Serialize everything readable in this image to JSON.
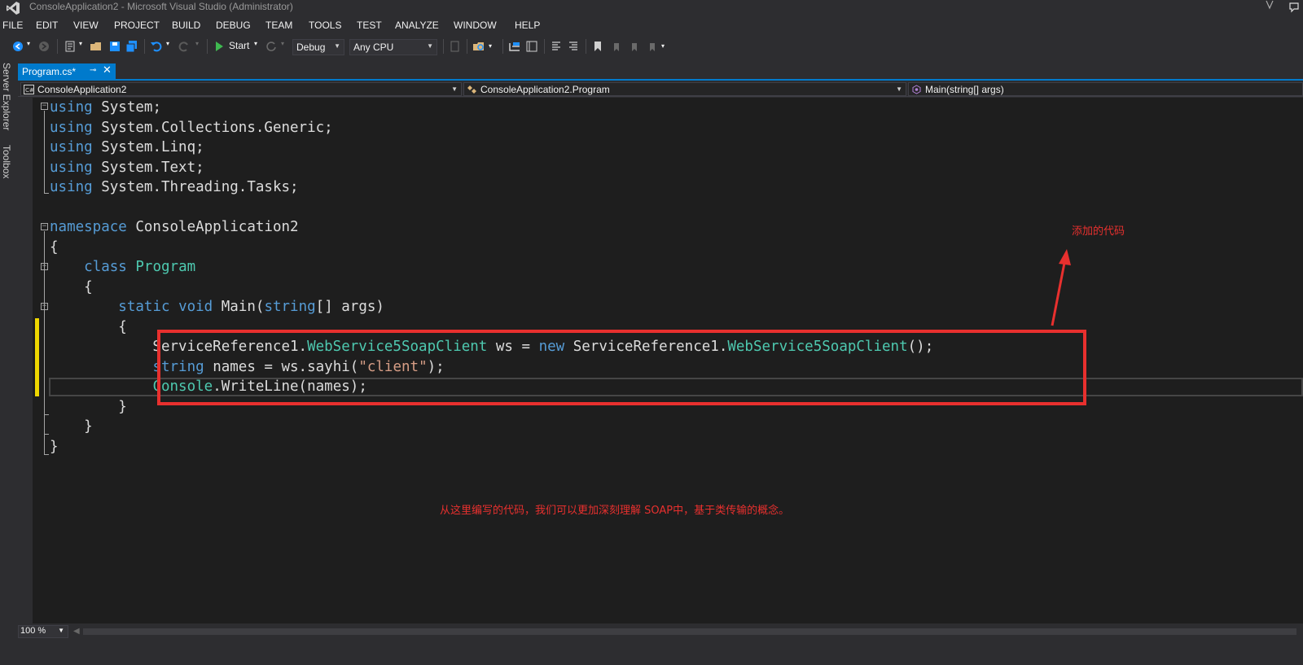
{
  "window": {
    "title": "ConsoleApplication2 - Microsoft Visual Studio (Administrator)"
  },
  "menu": [
    "FILE",
    "EDIT",
    "VIEW",
    "PROJECT",
    "BUILD",
    "DEBUG",
    "TEAM",
    "TOOLS",
    "TEST",
    "ANALYZE",
    "WINDOW",
    "HELP"
  ],
  "toolbar": {
    "start_label": "Start",
    "config_value": "Debug",
    "platform_value": "Any CPU"
  },
  "side_tabs": [
    "Server Explorer",
    "Toolbox"
  ],
  "doc_tab": {
    "label": "Program.cs*"
  },
  "navbar": {
    "project": "ConsoleApplication2",
    "type": "ConsoleApplication2.Program",
    "member": "Main(string[] args)"
  },
  "code": {
    "lines": [
      [
        [
          "kw",
          "using"
        ],
        [
          "t",
          " System;"
        ]
      ],
      [
        [
          "kw",
          "using"
        ],
        [
          "t",
          " System.Collections.Generic;"
        ]
      ],
      [
        [
          "kw",
          "using"
        ],
        [
          "t",
          " System.Linq;"
        ]
      ],
      [
        [
          "kw",
          "using"
        ],
        [
          "t",
          " System.Text;"
        ]
      ],
      [
        [
          "kw",
          "using"
        ],
        [
          "t",
          " System.Threading.Tasks;"
        ]
      ],
      [],
      [
        [
          "kw",
          "namespace"
        ],
        [
          "t",
          " ConsoleApplication2"
        ]
      ],
      [
        [
          "t",
          "{"
        ]
      ],
      [
        [
          "t",
          "    "
        ],
        [
          "kw",
          "class"
        ],
        [
          "t",
          " "
        ],
        [
          "ty",
          "Program"
        ]
      ],
      [
        [
          "t",
          "    {"
        ]
      ],
      [
        [
          "t",
          "        "
        ],
        [
          "kw",
          "static"
        ],
        [
          "t",
          " "
        ],
        [
          "kw",
          "void"
        ],
        [
          "t",
          " Main("
        ],
        [
          "kw",
          "string"
        ],
        [
          "t",
          "[] args)"
        ]
      ],
      [
        [
          "t",
          "        {"
        ]
      ],
      [
        [
          "t",
          "            ServiceReference1."
        ],
        [
          "ty",
          "WebService5SoapClient"
        ],
        [
          "t",
          " ws = "
        ],
        [
          "kw",
          "new"
        ],
        [
          "t",
          " ServiceReference1."
        ],
        [
          "ty",
          "WebService5SoapClient"
        ],
        [
          "t",
          "();"
        ]
      ],
      [
        [
          "t",
          "            "
        ],
        [
          "kw",
          "string"
        ],
        [
          "t",
          " names = ws.sayhi("
        ],
        [
          "st",
          "\"client\""
        ],
        [
          "t",
          ");"
        ]
      ],
      [
        [
          "t",
          "            "
        ],
        [
          "ty",
          "Console"
        ],
        [
          "t",
          ".WriteLine(names);"
        ]
      ],
      [
        [
          "t",
          "        }"
        ]
      ],
      [
        [
          "t",
          "    }"
        ]
      ],
      [
        [
          "t",
          "}"
        ]
      ]
    ]
  },
  "annotations": {
    "added_code": "添加的代码",
    "note": "从这里编写的代码，我们可以更加深刻理解 SOAP中，基于类传输的概念。"
  },
  "bottom": {
    "zoom": "100 %"
  },
  "colors": {
    "accent": "#007acc",
    "annotation": "#e8302e",
    "change_marker": "#efd700",
    "keyword": "#569cd6",
    "type": "#4ec9b0",
    "string": "#d69d85"
  }
}
